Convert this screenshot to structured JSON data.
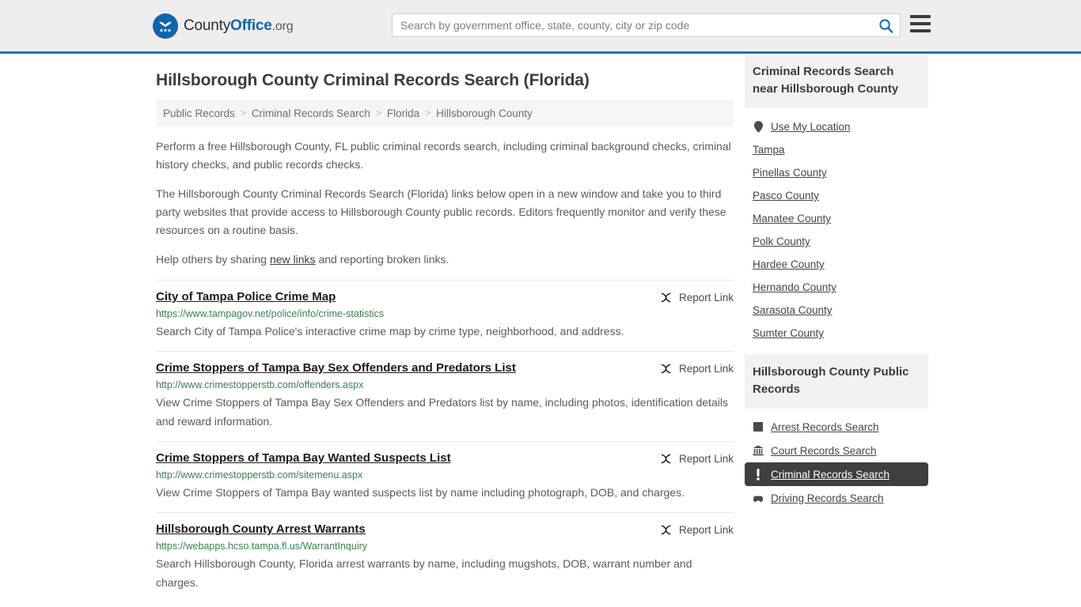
{
  "header": {
    "logo_name": "CountyOffice",
    "logo_prefix": "County",
    "logo_bold": "Office",
    "logo_suffix": ".org",
    "search_placeholder": "Search by government office, state, county, city or zip code",
    "search_value": "",
    "search_icon": "search-icon",
    "menu_icon": "hamburger-menu-icon",
    "accent_color": "#2f6fa8"
  },
  "page": {
    "title": "Hillsborough County Criminal Records Search (Florida)"
  },
  "breadcrumb": {
    "separator": ">",
    "items": [
      {
        "label": "Public Records"
      },
      {
        "label": "Criminal Records Search"
      },
      {
        "label": "Florida"
      },
      {
        "label": "Hillsborough County"
      }
    ]
  },
  "intro": {
    "p1": "Perform a free Hillsborough County, FL public criminal records search, including criminal background checks, criminal history checks, and public records checks.",
    "p2": "The Hillsborough County Criminal Records Search (Florida) links below open in a new window and take you to third party websites that provide access to Hillsborough County public records. Editors frequently monitor and verify these resources on a routine basis.",
    "p3_before": "Help others by sharing ",
    "p3_link": "new links",
    "p3_after": " and reporting broken links."
  },
  "results": {
    "report_label": "Report Link",
    "report_icon": "broken-link-icon",
    "items": [
      {
        "title": "City of Tampa Police Crime Map",
        "url": "https://www.tampagov.net/police/info/crime-statistics",
        "description": "Search City of Tampa Police's interactive crime map by crime type, neighborhood, and address."
      },
      {
        "title": "Crime Stoppers of Tampa Bay Sex Offenders and Predators List",
        "url": "http://www.crimestopperstb.com/offenders.aspx",
        "description": "View Crime Stoppers of Tampa Bay Sex Offenders and Predators list by name, including photos, identification details and reward information."
      },
      {
        "title": "Crime Stoppers of Tampa Bay Wanted Suspects List",
        "url": "http://www.crimestopperstb.com/sitemenu.aspx",
        "description": "View Crime Stoppers of Tampa Bay wanted suspects list by name including photograph, DOB, and charges."
      },
      {
        "title": "Hillsborough County Arrest Warrants",
        "url": "https://webapps.hcso.tampa.fl.us/WarrantInquiry",
        "description": "Search Hillsborough County, Florida arrest warrants by name, including mugshots, DOB, warrant number and charges."
      }
    ]
  },
  "sidebar": {
    "nearby": {
      "heading": "Criminal Records Search near Hillsborough County",
      "use_my_location": {
        "label": "Use My Location",
        "icon": "map-pin-icon"
      },
      "places": [
        {
          "label": "Tampa"
        },
        {
          "label": "Pinellas County"
        },
        {
          "label": "Pasco County"
        },
        {
          "label": "Manatee County"
        },
        {
          "label": "Polk County"
        },
        {
          "label": "Hardee County"
        },
        {
          "label": "Hernando County"
        },
        {
          "label": "Sarasota County"
        },
        {
          "label": "Sumter County"
        }
      ]
    },
    "public_records": {
      "heading": "Hillsborough County Public Records",
      "items": [
        {
          "label": "Arrest Records Search",
          "icon": "fingerprint-icon",
          "active": false
        },
        {
          "label": "Court Records Search",
          "icon": "courthouse-icon",
          "active": false
        },
        {
          "label": "Criminal Records Search",
          "icon": "alert-icon",
          "active": true
        },
        {
          "label": "Driving Records Search",
          "icon": "car-icon",
          "active": false
        }
      ],
      "active_bg": "#3f3f3f"
    }
  }
}
